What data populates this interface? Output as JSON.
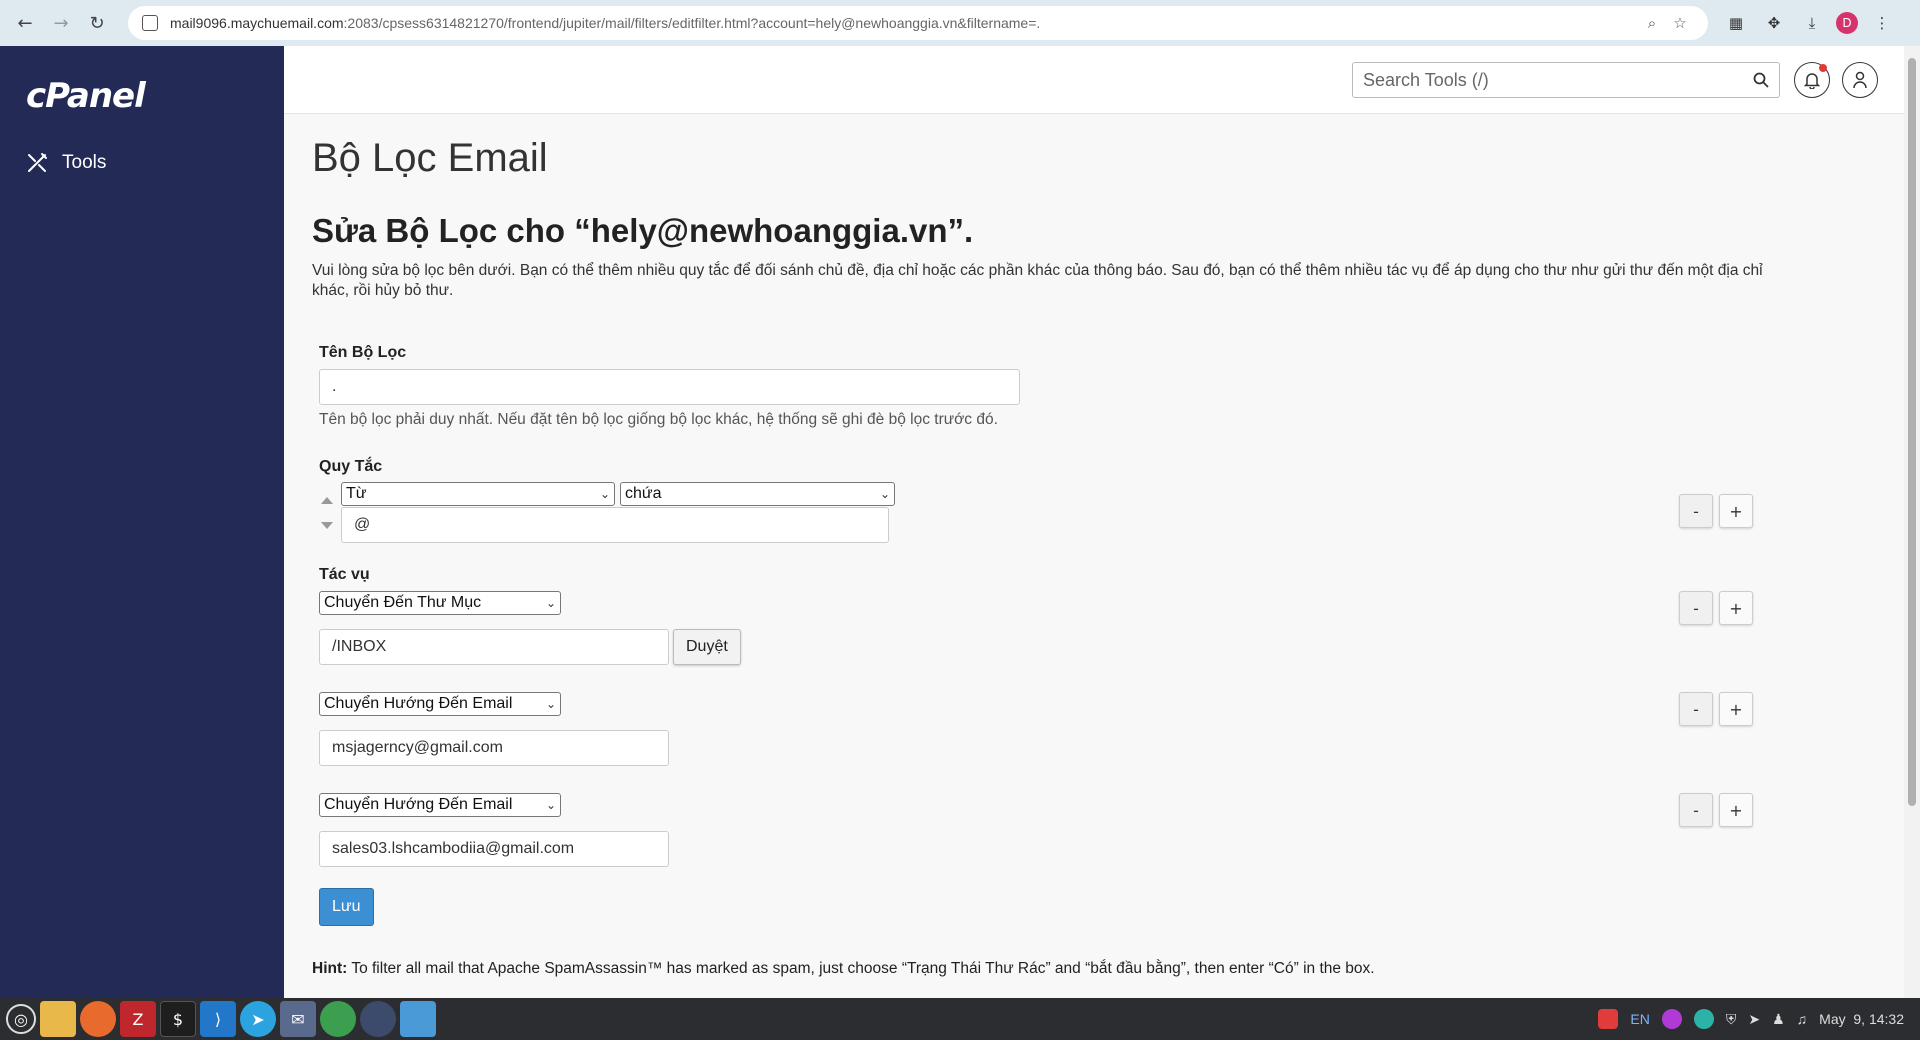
{
  "browser": {
    "url_host": "mail9096.maychuemail.com",
    "url_rest": ":2083/cpsess6314821270/frontend/jupiter/mail/filters/editfilter.html?account=hely@newhoanggia.vn&filtername=.",
    "profile_initial": "D"
  },
  "sidebar": {
    "logo": "cPanel",
    "tools_label": "Tools"
  },
  "header": {
    "search_placeholder": "Search Tools (/)"
  },
  "page": {
    "title": "Bộ Lọc Email",
    "subtitle": "Sửa Bộ Lọc cho “hely@newhoanggia.vn”.",
    "description": "Vui lòng sửa bộ lọc bên dưới. Bạn có thể thêm nhiều quy tắc để đối sánh chủ đề, địa chỉ hoặc các phần khác của thông báo. Sau đó, bạn có thể thêm nhiều tác vụ để áp dụng cho thư như gửi thư đến một địa chỉ khác, rồi hủy bỏ thư."
  },
  "form": {
    "filter_name_label": "Tên Bộ Lọc",
    "filter_name_value": ".",
    "filter_name_help": "Tên bộ lọc phải duy nhất. Nếu đặt tên bộ lọc giống bộ lọc khác, hệ thống sẽ ghi đè bộ lọc trước đó.",
    "rules_label": "Quy Tắc",
    "rule": {
      "part": "Từ",
      "match": "chứa",
      "value": "@"
    },
    "actions_label": "Tác vụ",
    "actions": [
      {
        "type": "Chuyển Đến Thư Mục",
        "value": "/INBOX",
        "browse_label": "Duyệt"
      },
      {
        "type": "Chuyển Hướng Đến Email",
        "value": "msjagerncy@gmail.com"
      },
      {
        "type": "Chuyển Hướng Đến Email",
        "value": "sales03.lshcambodiia@gmail.com"
      }
    ],
    "minus_label": "-",
    "plus_label": "+",
    "save_label": "Lưu"
  },
  "hint": {
    "prefix": "Hint:",
    "text": "To filter all mail that Apache SpamAssassin™ has marked as spam, just choose “Trạng Thái Thư Rác” and “bắt đầu bằng”, then enter “Có” in the box."
  },
  "taskbar": {
    "lang": "EN",
    "clock": "May  9, 14:32"
  }
}
